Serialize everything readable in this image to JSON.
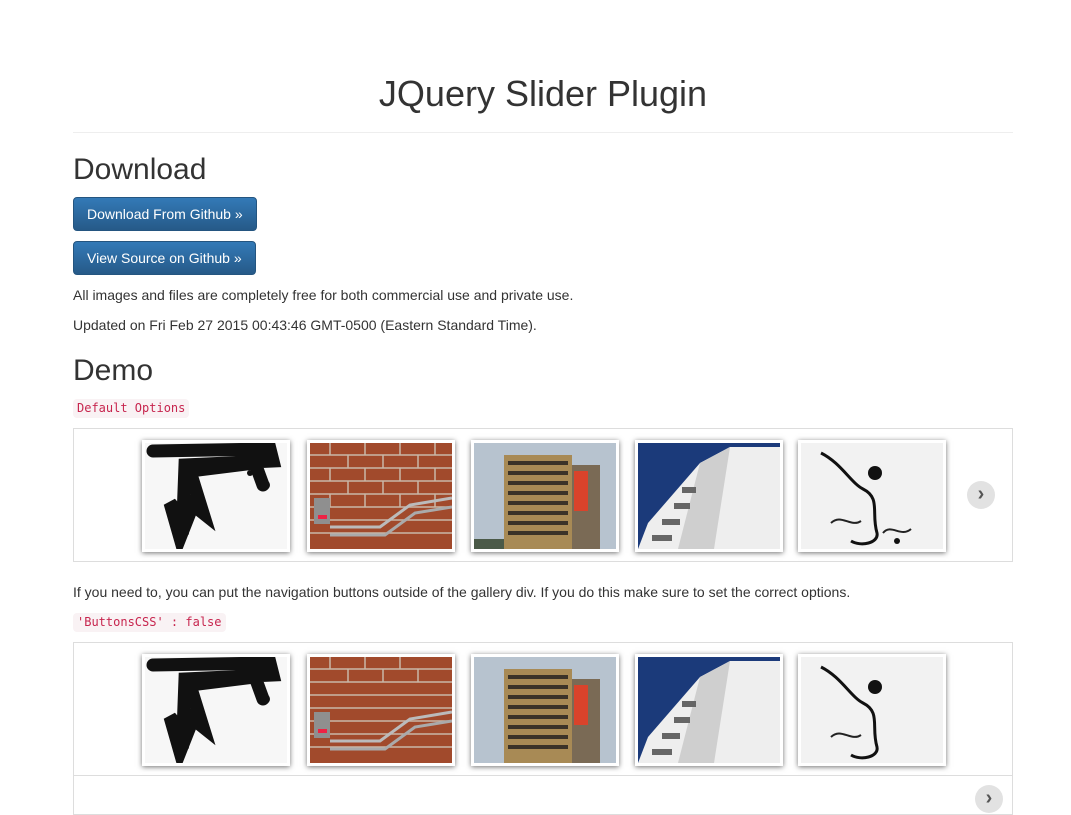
{
  "header": {
    "title": "JQuery Slider Plugin"
  },
  "download": {
    "heading": "Download",
    "download_button": "Download From Github »",
    "source_button": "View Source on Github »",
    "license_text": "All images and files are completely free for both commercial use and private use.",
    "updated_text": "Updated on Fri Feb 27 2015 00:43:46 GMT-0500 (Eastern Standard Time)."
  },
  "demo": {
    "heading": "Demo",
    "code_default": "Default Options",
    "outside_text": "If you need to, you can put the navigation buttons outside of the gallery div. If you do this make sure to set the correct options.",
    "code_buttons": "'ButtonsCSS' : false",
    "next_icon": "›"
  },
  "icons": [
    "chevron-right-icon"
  ],
  "colors": {
    "button_blue": "#337ab7",
    "code_red": "#c7254e",
    "code_bg": "#f9f2f4"
  }
}
